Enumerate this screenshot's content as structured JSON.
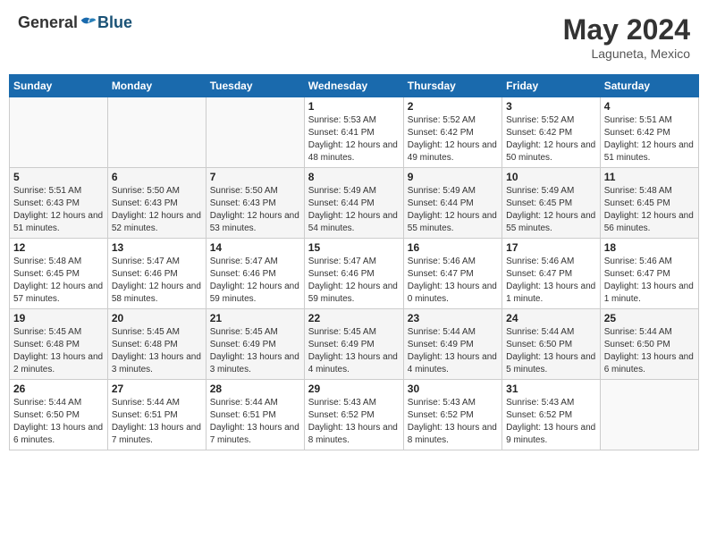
{
  "header": {
    "logo_general": "General",
    "logo_blue": "Blue",
    "month_year": "May 2024",
    "location": "Laguneta, Mexico"
  },
  "weekdays": [
    "Sunday",
    "Monday",
    "Tuesday",
    "Wednesday",
    "Thursday",
    "Friday",
    "Saturday"
  ],
  "weeks": [
    [
      {
        "day": "",
        "sunrise": "",
        "sunset": "",
        "daylight": ""
      },
      {
        "day": "",
        "sunrise": "",
        "sunset": "",
        "daylight": ""
      },
      {
        "day": "",
        "sunrise": "",
        "sunset": "",
        "daylight": ""
      },
      {
        "day": "1",
        "sunrise": "Sunrise: 5:53 AM",
        "sunset": "Sunset: 6:41 PM",
        "daylight": "Daylight: 12 hours and 48 minutes."
      },
      {
        "day": "2",
        "sunrise": "Sunrise: 5:52 AM",
        "sunset": "Sunset: 6:42 PM",
        "daylight": "Daylight: 12 hours and 49 minutes."
      },
      {
        "day": "3",
        "sunrise": "Sunrise: 5:52 AM",
        "sunset": "Sunset: 6:42 PM",
        "daylight": "Daylight: 12 hours and 50 minutes."
      },
      {
        "day": "4",
        "sunrise": "Sunrise: 5:51 AM",
        "sunset": "Sunset: 6:42 PM",
        "daylight": "Daylight: 12 hours and 51 minutes."
      }
    ],
    [
      {
        "day": "5",
        "sunrise": "Sunrise: 5:51 AM",
        "sunset": "Sunset: 6:43 PM",
        "daylight": "Daylight: 12 hours and 51 minutes."
      },
      {
        "day": "6",
        "sunrise": "Sunrise: 5:50 AM",
        "sunset": "Sunset: 6:43 PM",
        "daylight": "Daylight: 12 hours and 52 minutes."
      },
      {
        "day": "7",
        "sunrise": "Sunrise: 5:50 AM",
        "sunset": "Sunset: 6:43 PM",
        "daylight": "Daylight: 12 hours and 53 minutes."
      },
      {
        "day": "8",
        "sunrise": "Sunrise: 5:49 AM",
        "sunset": "Sunset: 6:44 PM",
        "daylight": "Daylight: 12 hours and 54 minutes."
      },
      {
        "day": "9",
        "sunrise": "Sunrise: 5:49 AM",
        "sunset": "Sunset: 6:44 PM",
        "daylight": "Daylight: 12 hours and 55 minutes."
      },
      {
        "day": "10",
        "sunrise": "Sunrise: 5:49 AM",
        "sunset": "Sunset: 6:45 PM",
        "daylight": "Daylight: 12 hours and 55 minutes."
      },
      {
        "day": "11",
        "sunrise": "Sunrise: 5:48 AM",
        "sunset": "Sunset: 6:45 PM",
        "daylight": "Daylight: 12 hours and 56 minutes."
      }
    ],
    [
      {
        "day": "12",
        "sunrise": "Sunrise: 5:48 AM",
        "sunset": "Sunset: 6:45 PM",
        "daylight": "Daylight: 12 hours and 57 minutes."
      },
      {
        "day": "13",
        "sunrise": "Sunrise: 5:47 AM",
        "sunset": "Sunset: 6:46 PM",
        "daylight": "Daylight: 12 hours and 58 minutes."
      },
      {
        "day": "14",
        "sunrise": "Sunrise: 5:47 AM",
        "sunset": "Sunset: 6:46 PM",
        "daylight": "Daylight: 12 hours and 59 minutes."
      },
      {
        "day": "15",
        "sunrise": "Sunrise: 5:47 AM",
        "sunset": "Sunset: 6:46 PM",
        "daylight": "Daylight: 12 hours and 59 minutes."
      },
      {
        "day": "16",
        "sunrise": "Sunrise: 5:46 AM",
        "sunset": "Sunset: 6:47 PM",
        "daylight": "Daylight: 13 hours and 0 minutes."
      },
      {
        "day": "17",
        "sunrise": "Sunrise: 5:46 AM",
        "sunset": "Sunset: 6:47 PM",
        "daylight": "Daylight: 13 hours and 1 minute."
      },
      {
        "day": "18",
        "sunrise": "Sunrise: 5:46 AM",
        "sunset": "Sunset: 6:47 PM",
        "daylight": "Daylight: 13 hours and 1 minute."
      }
    ],
    [
      {
        "day": "19",
        "sunrise": "Sunrise: 5:45 AM",
        "sunset": "Sunset: 6:48 PM",
        "daylight": "Daylight: 13 hours and 2 minutes."
      },
      {
        "day": "20",
        "sunrise": "Sunrise: 5:45 AM",
        "sunset": "Sunset: 6:48 PM",
        "daylight": "Daylight: 13 hours and 3 minutes."
      },
      {
        "day": "21",
        "sunrise": "Sunrise: 5:45 AM",
        "sunset": "Sunset: 6:49 PM",
        "daylight": "Daylight: 13 hours and 3 minutes."
      },
      {
        "day": "22",
        "sunrise": "Sunrise: 5:45 AM",
        "sunset": "Sunset: 6:49 PM",
        "daylight": "Daylight: 13 hours and 4 minutes."
      },
      {
        "day": "23",
        "sunrise": "Sunrise: 5:44 AM",
        "sunset": "Sunset: 6:49 PM",
        "daylight": "Daylight: 13 hours and 4 minutes."
      },
      {
        "day": "24",
        "sunrise": "Sunrise: 5:44 AM",
        "sunset": "Sunset: 6:50 PM",
        "daylight": "Daylight: 13 hours and 5 minutes."
      },
      {
        "day": "25",
        "sunrise": "Sunrise: 5:44 AM",
        "sunset": "Sunset: 6:50 PM",
        "daylight": "Daylight: 13 hours and 6 minutes."
      }
    ],
    [
      {
        "day": "26",
        "sunrise": "Sunrise: 5:44 AM",
        "sunset": "Sunset: 6:50 PM",
        "daylight": "Daylight: 13 hours and 6 minutes."
      },
      {
        "day": "27",
        "sunrise": "Sunrise: 5:44 AM",
        "sunset": "Sunset: 6:51 PM",
        "daylight": "Daylight: 13 hours and 7 minutes."
      },
      {
        "day": "28",
        "sunrise": "Sunrise: 5:44 AM",
        "sunset": "Sunset: 6:51 PM",
        "daylight": "Daylight: 13 hours and 7 minutes."
      },
      {
        "day": "29",
        "sunrise": "Sunrise: 5:43 AM",
        "sunset": "Sunset: 6:52 PM",
        "daylight": "Daylight: 13 hours and 8 minutes."
      },
      {
        "day": "30",
        "sunrise": "Sunrise: 5:43 AM",
        "sunset": "Sunset: 6:52 PM",
        "daylight": "Daylight: 13 hours and 8 minutes."
      },
      {
        "day": "31",
        "sunrise": "Sunrise: 5:43 AM",
        "sunset": "Sunset: 6:52 PM",
        "daylight": "Daylight: 13 hours and 9 minutes."
      },
      {
        "day": "",
        "sunrise": "",
        "sunset": "",
        "daylight": ""
      }
    ]
  ]
}
